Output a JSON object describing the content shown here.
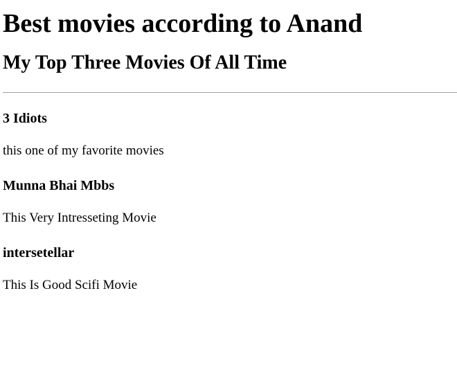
{
  "page": {
    "heading": "Best movies according to Anand",
    "subheading": "My Top Three Movies Of All Time"
  },
  "movies": [
    {
      "title": "3 Idiots",
      "description": "this one of my favorite movies"
    },
    {
      "title": "Munna Bhai Mbbs",
      "description": "This Very Intresseting Movie"
    },
    {
      "title": "intersetellar",
      "description": "This Is Good Scifi Movie"
    }
  ]
}
